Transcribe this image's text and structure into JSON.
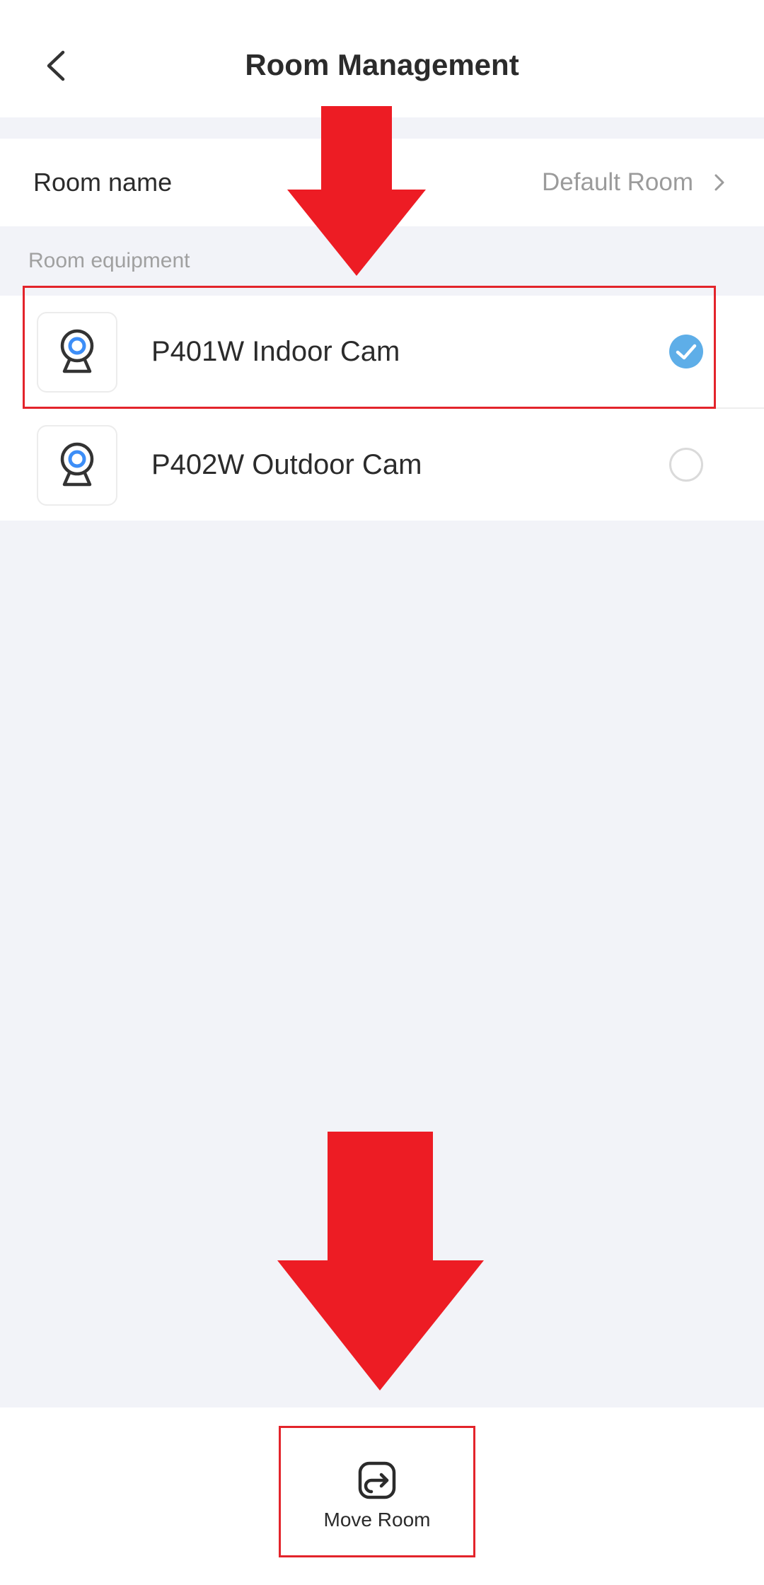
{
  "header": {
    "title": "Room Management",
    "back_icon": "chevron-left-icon"
  },
  "room_name_row": {
    "label": "Room name",
    "value": "Default Room",
    "chevron_icon": "chevron-right-icon"
  },
  "equipment": {
    "section_label": "Room equipment",
    "devices": [
      {
        "name": "P401W Indoor Cam",
        "icon": "camera-icon",
        "selected": true
      },
      {
        "name": "P402W Outdoor Cam",
        "icon": "camera-icon",
        "selected": false
      }
    ]
  },
  "footer": {
    "move_room_label": "Move Room",
    "move_room_icon": "move-room-icon"
  },
  "colors": {
    "accent_check": "#5eaee8",
    "annotation_red": "#e3242b",
    "camera_lens": "#3d8ef7",
    "page_background": "#f2f3f8"
  }
}
